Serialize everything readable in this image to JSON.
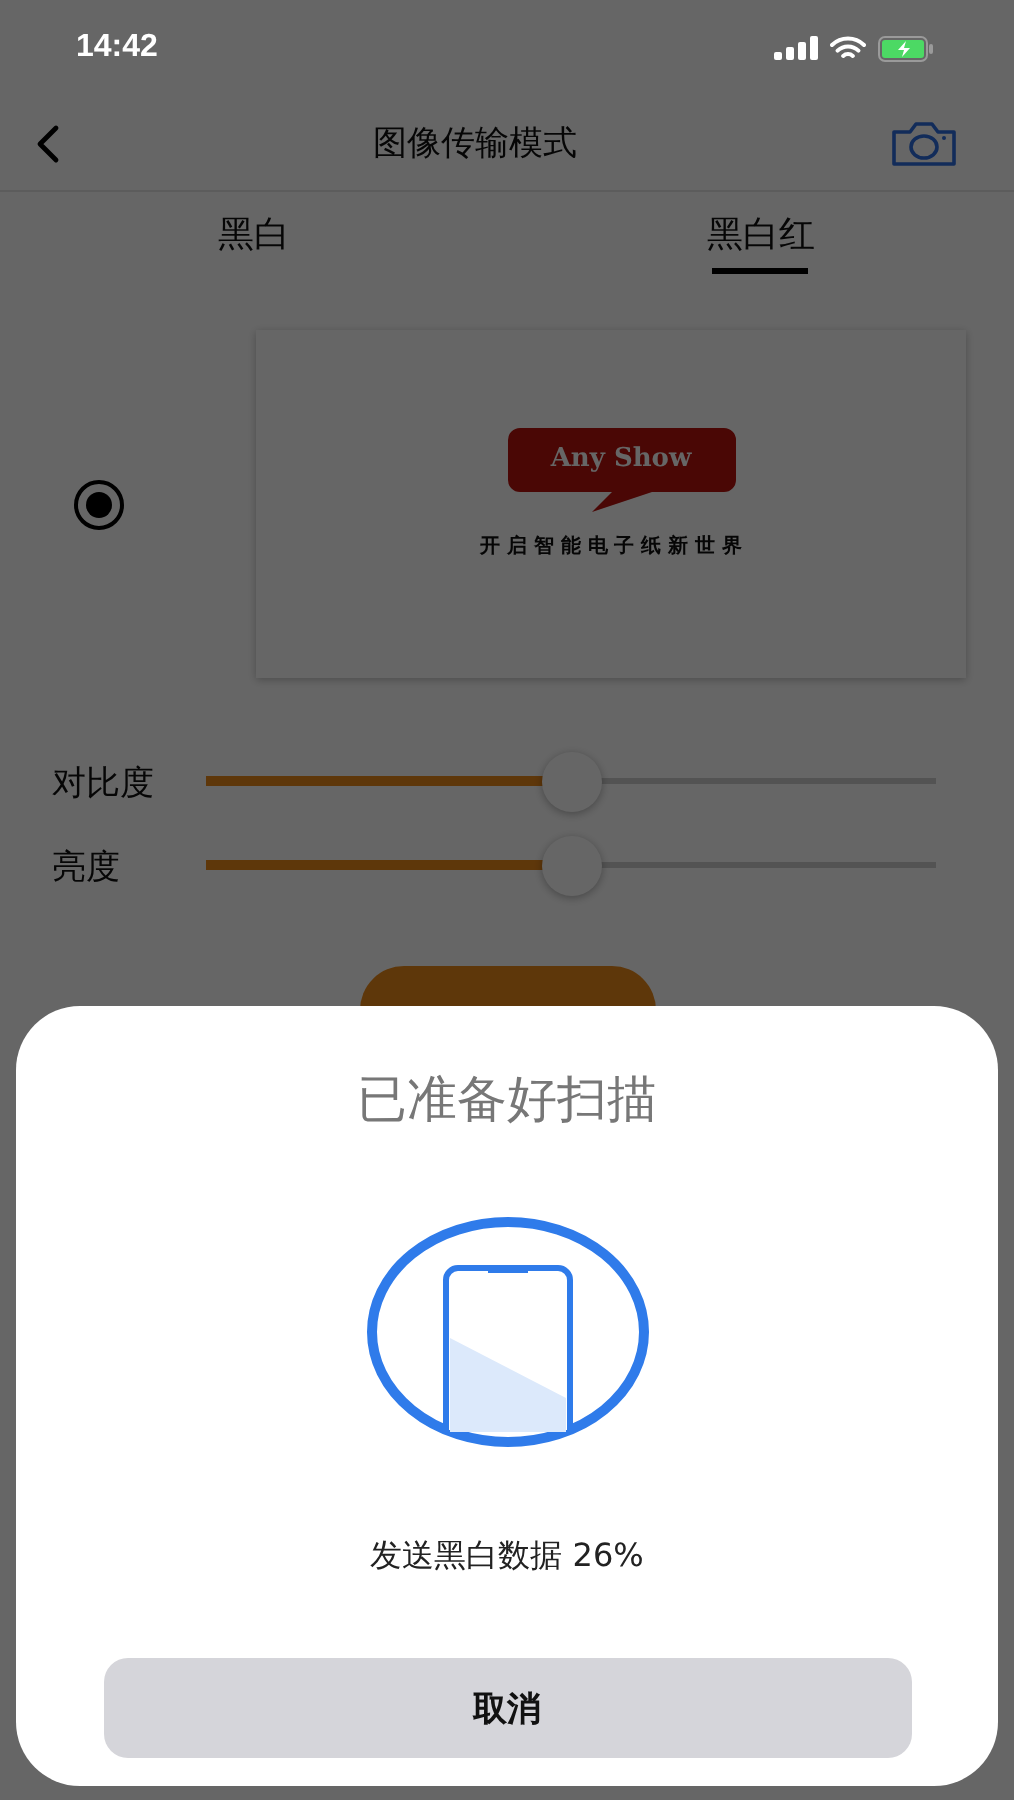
{
  "status_bar": {
    "time": "14:42"
  },
  "nav_bar": {
    "title": "图像传输模式"
  },
  "tabs": [
    {
      "label": "黑白",
      "selected": false
    },
    {
      "label": "黑白红",
      "selected": true
    }
  ],
  "preview": {
    "selected": true,
    "logo_text": "Any Show",
    "tagline": "开 启 智 能 电 子 纸 新 世 界"
  },
  "sliders": [
    {
      "label": "对比度",
      "level": 0.5
    },
    {
      "label": "亮度",
      "level": 0.5
    }
  ],
  "scan_sheet": {
    "title": "已准备好扫描",
    "progress_text": "发送黑白数据 26%",
    "cancel_button": "取消"
  }
}
